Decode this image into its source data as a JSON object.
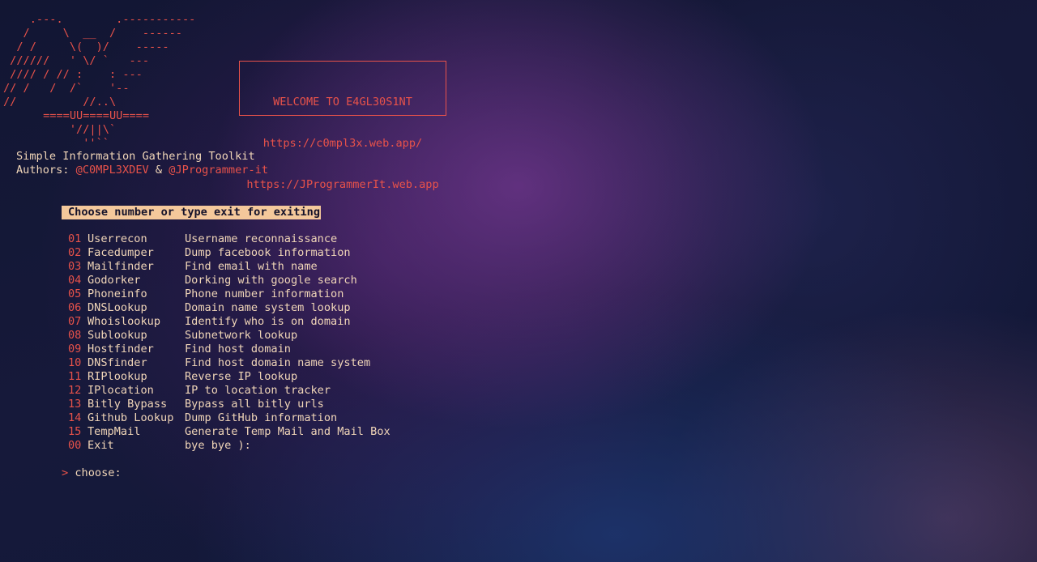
{
  "banner": {
    "ascii_art": "    .---.        .-----------\n   /     \\  __  /    ------\n  / /     \\(  )/    -----\n //////   ' \\/ `   ---\n //// / // :    : ---\n// /   /  /`    '--\n//          //..\\\n      ====UU====UU====\n          '//||\\`\n            ''``"
  },
  "welcome": {
    "title": "WELCOME TO E4GL30S1NT",
    "link1": "https://c0mpl3x.web.app/",
    "link2": "https://JProgrammerIt.web.app"
  },
  "info": {
    "tagline": "Simple Information Gathering Toolkit",
    "authors_label": "Authors: ",
    "author1": "@C0MPL3XDEV",
    "separator": " & ",
    "author2": "@JProgrammer-it"
  },
  "prompt": {
    "banner": "Choose number or type exit for exiting",
    "arrow": ">",
    "input_label": "choose:"
  },
  "menu": [
    {
      "num": "01",
      "name": "Userrecon",
      "desc": "Username reconnaissance"
    },
    {
      "num": "02",
      "name": "Facedumper",
      "desc": "Dump facebook information"
    },
    {
      "num": "03",
      "name": "Mailfinder",
      "desc": "Find email with name"
    },
    {
      "num": "04",
      "name": "Godorker",
      "desc": "Dorking with google search"
    },
    {
      "num": "05",
      "name": "Phoneinfo",
      "desc": "Phone number information"
    },
    {
      "num": "06",
      "name": "DNSLookup",
      "desc": "Domain name system lookup"
    },
    {
      "num": "07",
      "name": "Whoislookup",
      "desc": "Identify who is on domain"
    },
    {
      "num": "08",
      "name": "Sublookup",
      "desc": "Subnetwork lookup"
    },
    {
      "num": "09",
      "name": "Hostfinder",
      "desc": "Find host domain"
    },
    {
      "num": "10",
      "name": "DNSfinder",
      "desc": "Find host domain name system"
    },
    {
      "num": "11",
      "name": "RIPlookup",
      "desc": "Reverse IP lookup"
    },
    {
      "num": "12",
      "name": "IPlocation",
      "desc": "IP to location tracker"
    },
    {
      "num": "13",
      "name": "Bitly Bypass",
      "desc": "Bypass all bitly urls"
    },
    {
      "num": "14",
      "name": "Github Lookup",
      "desc": "Dump GitHub information"
    },
    {
      "num": "15",
      "name": "TempMail",
      "desc": "Generate Temp Mail and Mail Box"
    },
    {
      "num": "00",
      "name": "Exit",
      "desc": "bye bye ):"
    }
  ],
  "colors": {
    "accent": "#e8524a",
    "text": "#f1d6b8",
    "highlight_bg": "#f4c89b"
  }
}
